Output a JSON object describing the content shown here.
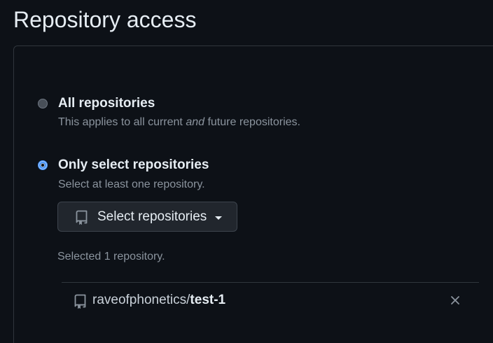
{
  "page": {
    "title": "Repository access"
  },
  "options": {
    "all": {
      "label": "All repositories",
      "description_before": "This applies to all current ",
      "description_em": "and",
      "description_after": " future repositories.",
      "selected": false
    },
    "select": {
      "label": "Only select repositories",
      "description": "Select at least one repository.",
      "selected": true
    }
  },
  "select_button": {
    "label": "Select repositories",
    "icon": "repo-icon"
  },
  "selected_count_text": "Selected 1 repository.",
  "selected_repos": [
    {
      "owner": "raveofphonetics/",
      "name": "test-1",
      "icon": "repo-icon",
      "remove_icon": "close-icon"
    }
  ],
  "colors": {
    "background": "#0d1117",
    "border": "#30363d",
    "accent": "#4493f8",
    "muted_text": "#8b949e",
    "button_bg": "#21262d"
  }
}
